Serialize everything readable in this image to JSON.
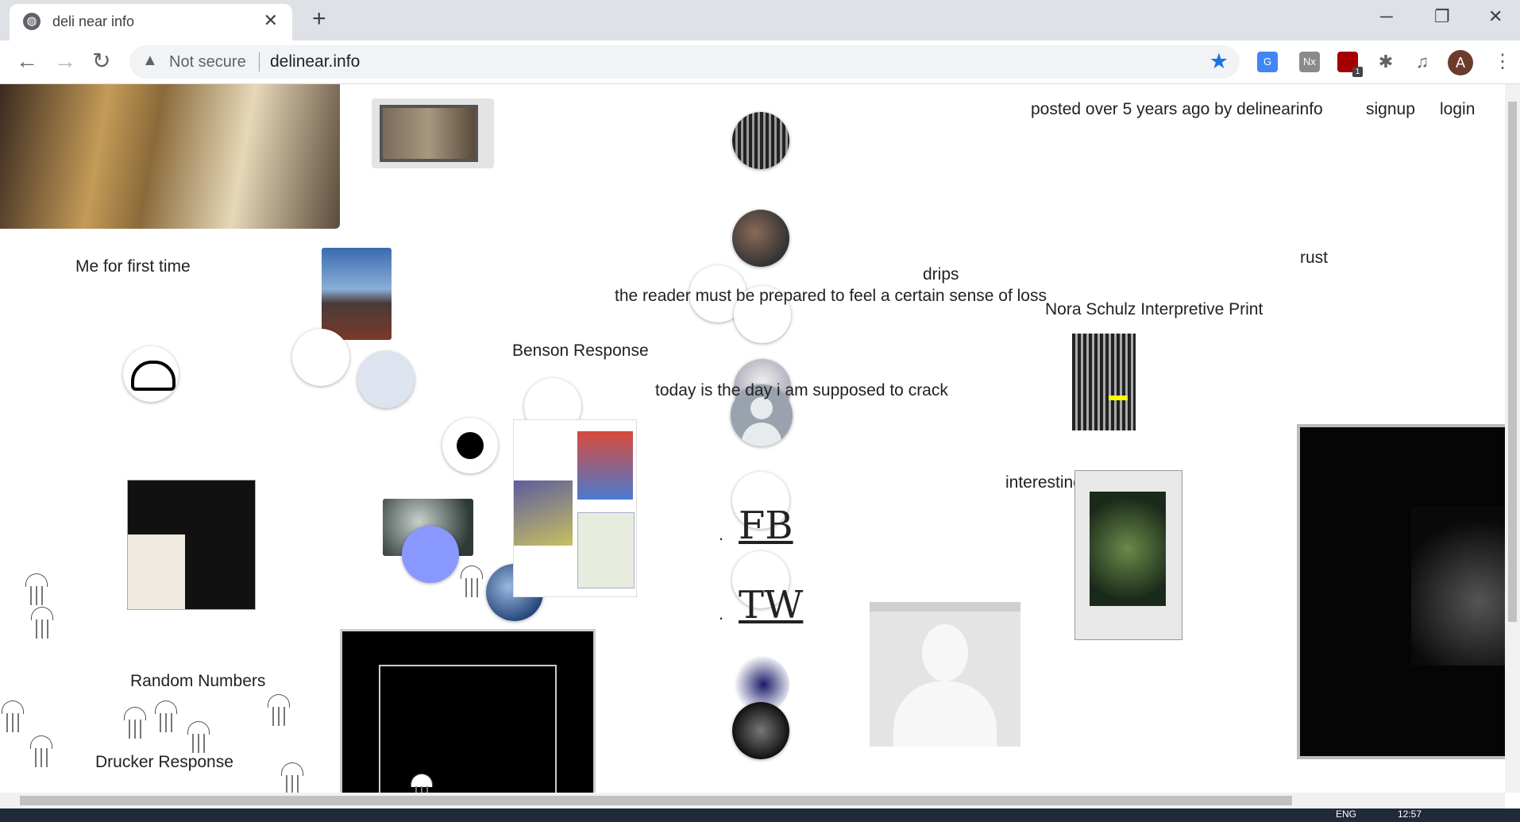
{
  "browser": {
    "tab_title": "deli near info",
    "security_label": "Not secure",
    "url": "delinear.info",
    "profile_initial": "A",
    "extension_badge": "1"
  },
  "header": {
    "posted": "posted over 5 years ago by delinearinfo",
    "signup": "signup",
    "login": "login"
  },
  "posts": {
    "me_first": "Me for first time",
    "drips": "drips",
    "reader_loss": "the reader must be prepared to feel a certain sense of loss",
    "rust": "rust",
    "nora": "Nora Schulz Interpretive Print",
    "benson": "Benson Response",
    "today_crack": "today is the day i am supposed to crack",
    "interesting": "interesting, Evelyn,",
    "random_numbers": "Random Numbers",
    "drucker": "Drucker Response",
    "fb": "FB",
    "tw": "TW",
    "bullet": "."
  },
  "taskbar": {
    "lang": "ENG",
    "time": "12:57"
  }
}
